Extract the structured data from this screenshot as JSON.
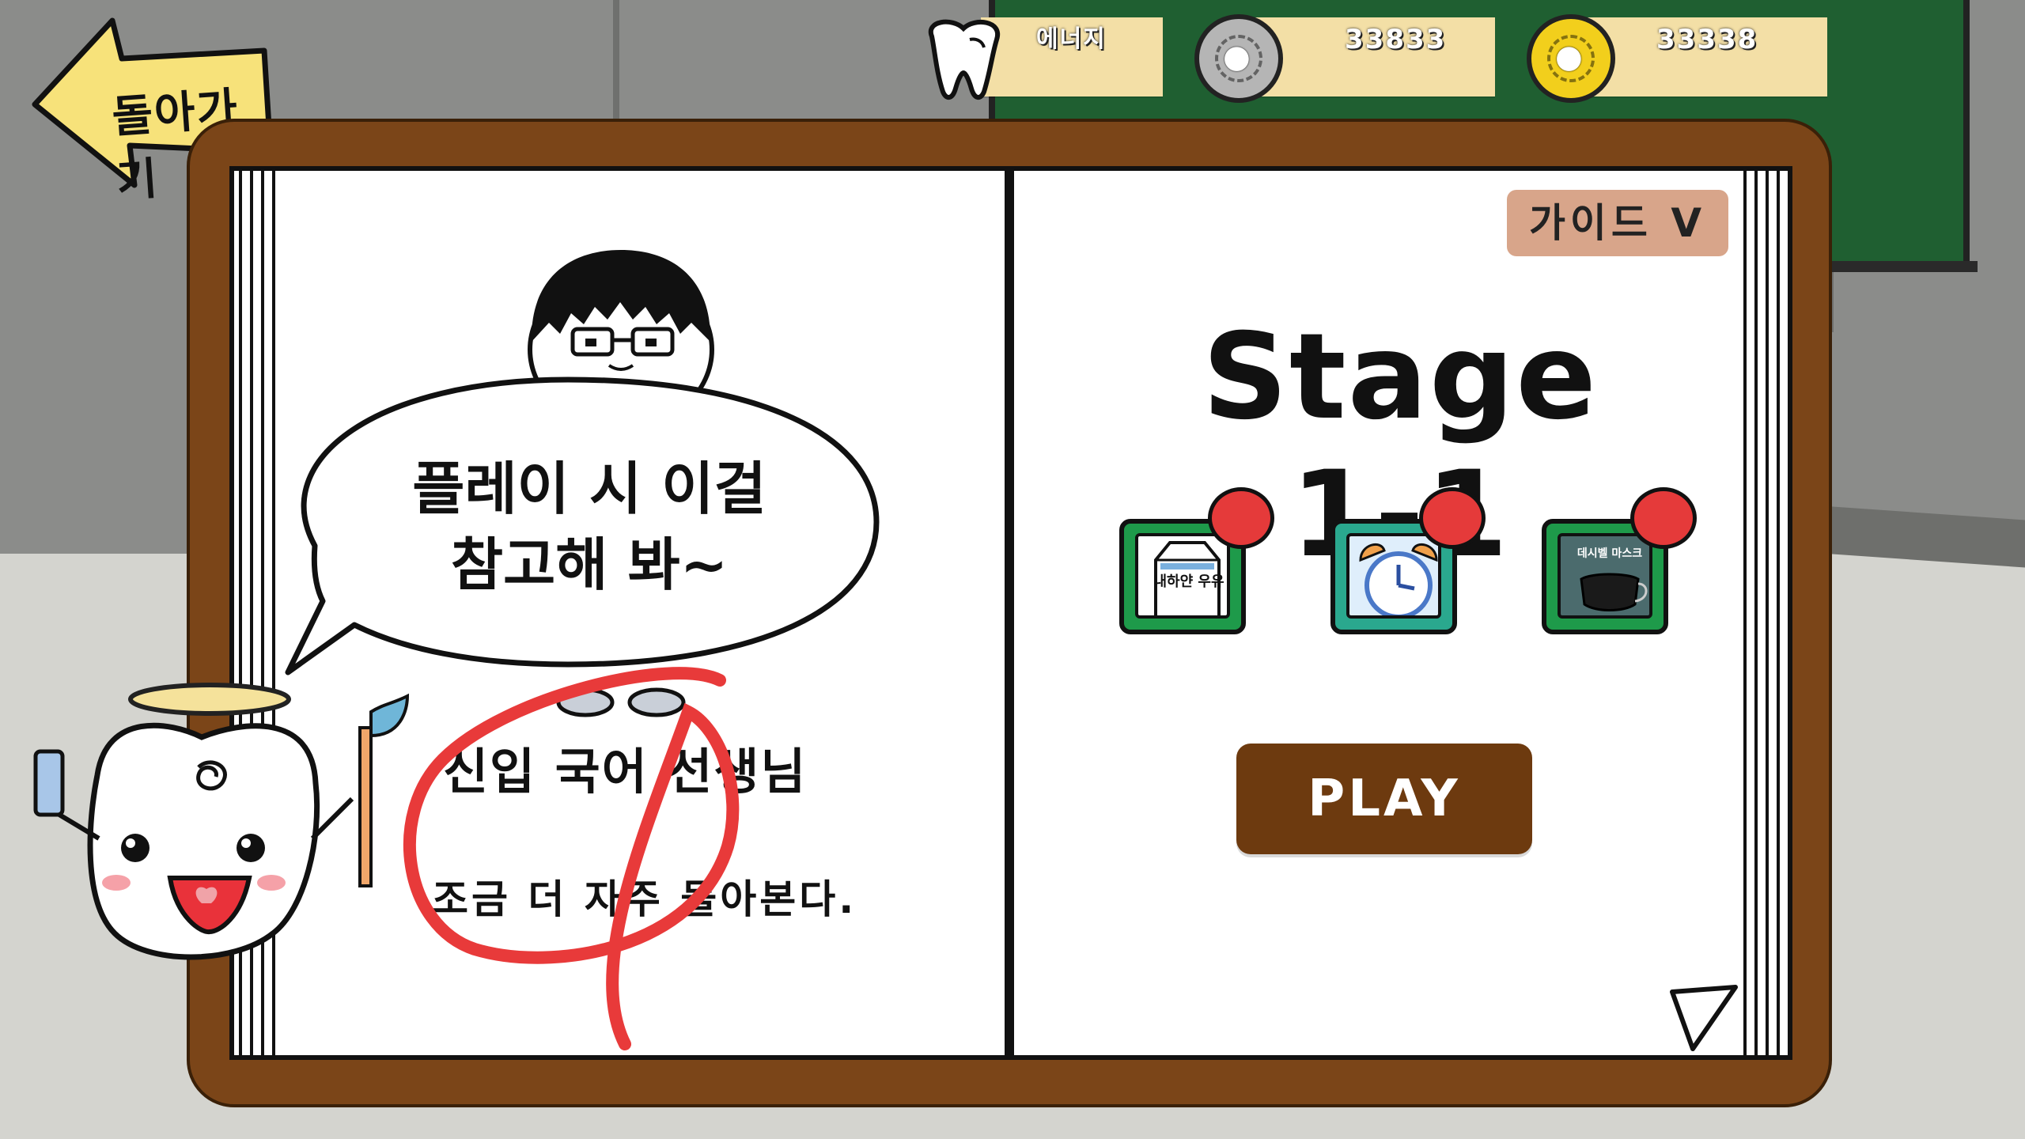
{
  "header": {
    "back_label": "돌아가기",
    "energy_label": "에너지",
    "silver_coins": "33833",
    "gold_coins": "33338"
  },
  "book": {
    "guide_label": "가이드  V",
    "stage_title": "Stage 1-1",
    "play_label": "PLAY",
    "missions": [
      {
        "icon": "milk-carton-icon",
        "text": "내하얀 우유"
      },
      {
        "icon": "alarm-clock-icon",
        "text": ""
      },
      {
        "icon": "face-mask-icon",
        "text": "데시벨 마스크"
      }
    ],
    "speech_line1": "플레이 시 이걸",
    "speech_line2": "참고해 봐~",
    "character_name": "신입 국어 선생님",
    "character_desc": "조금 더 자주 돌아본다."
  },
  "colors": {
    "board": "#7b4518",
    "play_button": "#6d3a0f",
    "guide_button": "#d8a58a",
    "chalkboard": "#1f5f31",
    "stat_strip": "#f3dfa6",
    "red_marker": "#e53a3a"
  }
}
